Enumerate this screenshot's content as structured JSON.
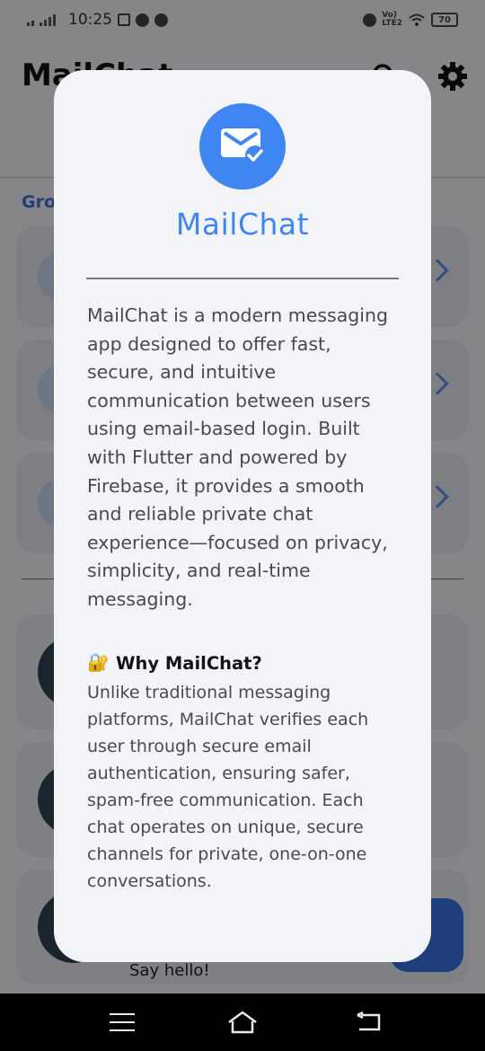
{
  "status_bar": {
    "time": "10:25",
    "lte_label": "Vo)\nLTE2",
    "battery": "70"
  },
  "background": {
    "app_title": "MailChat",
    "groups_label": "Gro",
    "chat_preview": "Say hello!"
  },
  "dialog": {
    "title": "MailChat",
    "description": "MailChat is a modern messaging app designed to offer fast, secure, and intuitive communication between users using email-based login. Built with Flutter and powered by Firebase, it provides a smooth and reliable private chat experience—focused on privacy, simplicity, and real-time messaging.",
    "why_emoji": "🔐",
    "why_heading": "Why MailChat?",
    "why_body": "Unlike traditional messaging platforms, MailChat verifies each user through secure email authentication, ensuring safer, spam-free communication. Each chat operates on unique, secure channels for private, one-on-one conversations."
  },
  "colors": {
    "accent": "#3f86f2",
    "dialog_bg": "#f3f4f8",
    "scrim": "rgba(0,0,0,0.45)"
  },
  "icons": {
    "logo": "mark-email-read-icon",
    "search": "search-icon",
    "settings": "gear-icon",
    "nav_menu": "menu-icon",
    "nav_home": "home-icon",
    "nav_back": "back-icon"
  }
}
